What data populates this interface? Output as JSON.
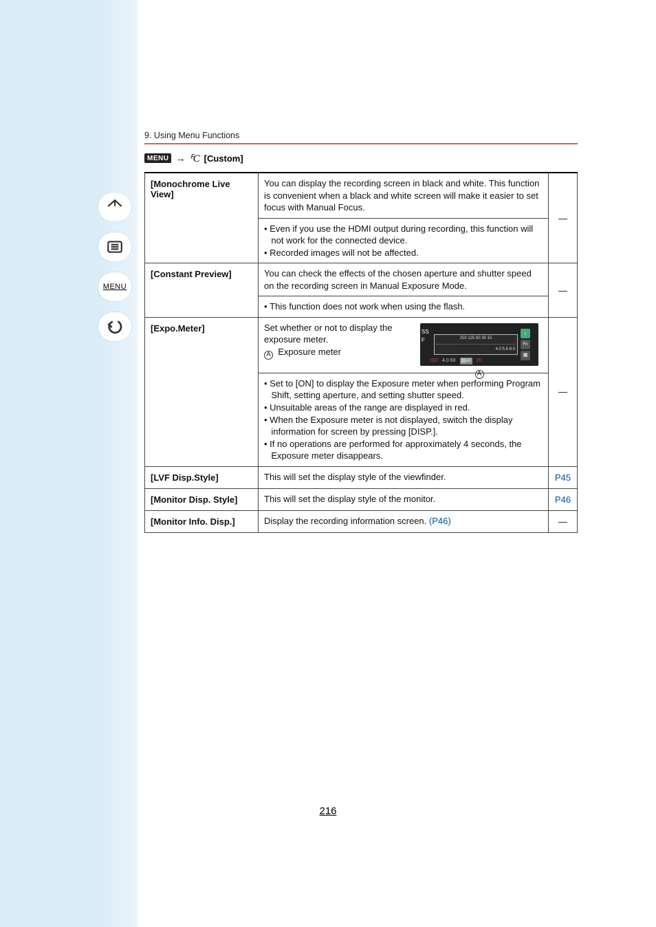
{
  "header": {
    "section": "9. Using Menu Functions"
  },
  "menu_path": {
    "menu_icon_text": "MENU",
    "arrow": "→",
    "custom_symbol": "ꟳC",
    "label": "[Custom]"
  },
  "rows": {
    "monochrome": {
      "name": "[Monochrome Live View]",
      "top": "You can display the recording screen in black and white. This function is convenient when a black and white screen will make it easier to set focus with Manual Focus.",
      "notes": [
        "Even if you use the HDMI output during recording, this function will not work for the connected device.",
        "Recorded images will not be affected."
      ],
      "right": "—"
    },
    "constant": {
      "name": "[Constant Preview]",
      "top": "You can check the effects of the chosen aperture and shutter speed on the recording screen in Manual Exposure Mode.",
      "notes": [
        "This function does not work when using the flash."
      ],
      "right": "—"
    },
    "expo": {
      "name": "[Expo.Meter]",
      "top_line1": "Set whether or not to display the exposure meter.",
      "legend_letter": "A",
      "legend_label": "Exposure meter",
      "notes": [
        "Set to [ON] to display the Exposure meter when performing Program Shift, setting aperture, and setting shutter speed.",
        "Unsuitable areas of the range are displayed in red.",
        "When the Exposure meter is not displayed, switch the display information for screen by pressing [DISP.].",
        "If no operations are performed for approximately 4 seconds, the Exposure meter disappears."
      ],
      "figure": {
        "ss_label": "SS",
        "f_label": "F",
        "ss_ticks": "250   125   60   30   15",
        "f_ticks": "4.0   5.6   8.0",
        "status_bar": "4.0 60",
        "ev": "±0",
        "iso_badge": "ISO",
        "remain": "20",
        "callout": "A"
      },
      "right": "—"
    },
    "lvf": {
      "name": "[LVF Disp.Style]",
      "desc": "This will set the display style of the viewfinder.",
      "right": "P45"
    },
    "monitor_style": {
      "name": "[Monitor Disp. Style]",
      "desc": "This will set the display style of the monitor.",
      "right": "P46"
    },
    "monitor_info": {
      "name": "[Monitor Info. Disp.]",
      "desc_prefix": "Display the recording information screen. ",
      "desc_link": "(P46)",
      "right": "—"
    }
  },
  "page_number": "216"
}
